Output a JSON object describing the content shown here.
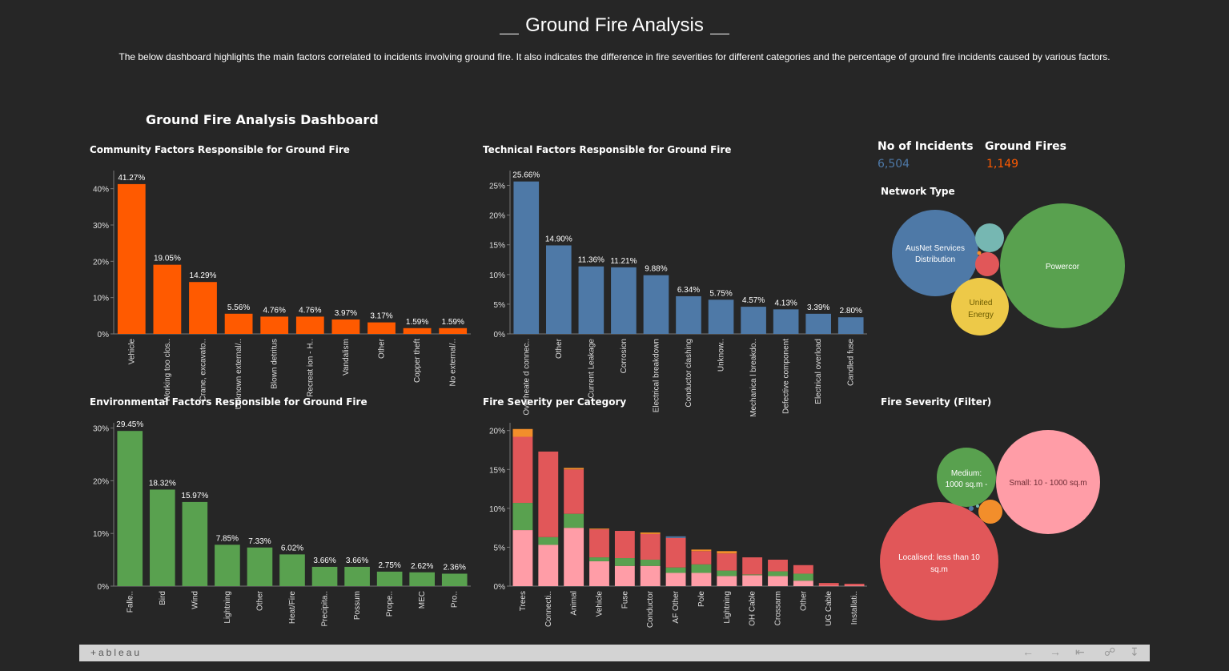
{
  "header": {
    "title": "Ground Fire Analysis",
    "subtitle": "The below dashboard highlights the main factors correlated to incidents involving ground fire. It also indicates the difference in fire severities for different categories and the percentage of ground fire incidents caused by various factors."
  },
  "dashboard_title": "Ground Fire Analysis Dashboard",
  "kpis": {
    "incidents_label": "No of Incidents",
    "incidents_value": "6,504",
    "ground_label": "Ground Fires",
    "ground_value": "1,149"
  },
  "network": {
    "title": "Network Type",
    "bubbles": [
      {
        "label": "Powercor",
        "color": "#59a14f"
      },
      {
        "label": "AusNet Services Distribution",
        "color": "#4e79a7"
      },
      {
        "label": "United Energy",
        "color": "#edc948"
      },
      {
        "label": "",
        "color": "#76b7b2"
      },
      {
        "label": "",
        "color": "#e15759"
      },
      {
        "label": "",
        "color": "#f28e2b"
      }
    ]
  },
  "severity_filter": {
    "title": "Fire Severity (Filter)",
    "bubbles": [
      {
        "label": "Localised: less than 10 sq.m",
        "color": "#e15759"
      },
      {
        "label": "Small: 10 - 1000 sq.m",
        "color": "#ff9da7"
      },
      {
        "label": "Medium: 1000 sq.m -",
        "color": "#59a14f"
      },
      {
        "label": "",
        "color": "#f28e2b"
      },
      {
        "label": "",
        "color": "#4e79a7"
      }
    ]
  },
  "footer": {
    "logo": "+ableau"
  },
  "chart_data": [
    {
      "id": "community",
      "type": "bar",
      "title": "Community Factors Responsible for Ground Fire",
      "color": "#ff5a00",
      "categories": [
        "Vehicle",
        "Working too clos..",
        "Crane, excavato..",
        "Unknown external/..",
        "Blown detritus",
        "Recreat ion - H..",
        "Vandalism",
        "Other",
        "Copper theft",
        "No external/.."
      ],
      "values": [
        41.27,
        19.05,
        14.29,
        5.56,
        4.76,
        4.76,
        3.97,
        3.17,
        1.59,
        1.59
      ],
      "labels": [
        "41.27%",
        "19.05%",
        "14.29%",
        "5.56%",
        "4.76%",
        "4.76%",
        "3.97%",
        "3.17%",
        "1.59%",
        "1.59%"
      ],
      "ylim": [
        0,
        45
      ],
      "yticks": [
        0,
        10,
        20,
        30,
        40
      ],
      "ytick_labels": [
        "0%",
        "10%",
        "20%",
        "30%",
        "40%"
      ]
    },
    {
      "id": "technical",
      "type": "bar",
      "title": "Technical Factors Responsible for Ground Fire",
      "color": "#4e79a7",
      "categories": [
        "Overheate d connec..",
        "Other",
        "Current Leakage",
        "Corrosion",
        "Electrical breakdown",
        "Conductor clashing",
        "Unknow..",
        "Mechanica l breakdo..",
        "Defective component",
        "Electrical overload",
        "Candled fuse"
      ],
      "values": [
        25.66,
        14.9,
        11.36,
        11.21,
        9.88,
        6.34,
        5.75,
        4.57,
        4.13,
        3.39,
        2.8
      ],
      "labels": [
        "25.66%",
        "14.90%",
        "11.36%",
        "11.21%",
        "9.88%",
        "6.34%",
        "5.75%",
        "4.57%",
        "4.13%",
        "3.39%",
        "2.80%"
      ],
      "ylim": [
        0,
        27.5
      ],
      "yticks": [
        0,
        5,
        10,
        15,
        20,
        25
      ],
      "ytick_labels": [
        "0%",
        "5%",
        "10%",
        "15%",
        "20%",
        "25%"
      ]
    },
    {
      "id": "environmental",
      "type": "bar",
      "title": "Environmental Factors Responsible for Ground Fire",
      "color": "#59a14f",
      "categories": [
        "Falle..",
        "Bird",
        "Wind",
        "Lightning",
        "Other",
        "Heat/Fire",
        "Precipita..",
        "Possum",
        "Prope..",
        "MEC",
        "Pro.."
      ],
      "values": [
        29.45,
        18.32,
        15.97,
        7.85,
        7.33,
        6.02,
        3.66,
        3.66,
        2.75,
        2.62,
        2.36
      ],
      "labels": [
        "29.45%",
        "18.32%",
        "15.97%",
        "7.85%",
        "7.33%",
        "6.02%",
        "3.66%",
        "3.66%",
        "2.75%",
        "2.62%",
        "2.36%"
      ],
      "ylim": [
        0,
        31
      ],
      "yticks": [
        0,
        10,
        20,
        30
      ],
      "ytick_labels": [
        "0%",
        "10%",
        "20%",
        "30%"
      ]
    },
    {
      "id": "severity",
      "type": "bar",
      "stacked": true,
      "title": "Fire Severity per Category",
      "categories": [
        "Trees",
        "Connecti..",
        "Animal",
        "Vehicle",
        "Fuse",
        "Conductor",
        "AF Other",
        "Pole",
        "Lightning",
        "OH Cable",
        "Crossarm",
        "Other",
        "UG Cable",
        "Installati.."
      ],
      "series": [
        {
          "color": "#ff9da7",
          "values": [
            7.2,
            5.3,
            7.5,
            3.2,
            2.6,
            2.6,
            1.7,
            1.7,
            1.3,
            1.4,
            1.3,
            0.7,
            0.05,
            0.05
          ]
        },
        {
          "color": "#59a14f",
          "values": [
            3.5,
            1.0,
            1.8,
            0.5,
            1.0,
            0.8,
            0.7,
            1.1,
            0.7,
            0.1,
            0.6,
            0.9,
            0.0,
            0.0
          ]
        },
        {
          "color": "#e15759",
          "values": [
            8.5,
            11.0,
            5.7,
            3.6,
            3.5,
            3.3,
            3.8,
            1.7,
            2.2,
            2.2,
            1.5,
            1.1,
            0.35,
            0.25
          ]
        },
        {
          "color": "#f28e2b",
          "values": [
            1.0,
            0.0,
            0.2,
            0.1,
            0.0,
            0.2,
            0.0,
            0.2,
            0.3,
            0.0,
            0.0,
            0.0,
            0.0,
            0.0
          ]
        },
        {
          "color": "#4e79a7",
          "values": [
            0.0,
            0.0,
            0.0,
            0.0,
            0.0,
            0.0,
            0.2,
            0.0,
            0.0,
            0.0,
            0.0,
            0.0,
            0.0,
            0.0
          ]
        }
      ],
      "ylim": [
        0,
        21
      ],
      "yticks": [
        0,
        5,
        10,
        15,
        20
      ],
      "ytick_labels": [
        "0%",
        "5%",
        "10%",
        "15%",
        "20%"
      ]
    }
  ]
}
